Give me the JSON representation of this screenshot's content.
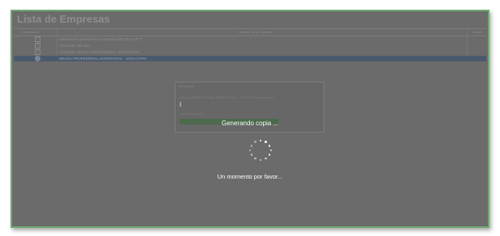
{
  "window": {
    "title": "Lista de Empresas"
  },
  "grid": {
    "columns": [
      "Seleccionar",
      "Nombre de la Empresa",
      "Estado"
    ],
    "rows": [
      {
        "name": "Información general de la empresa (HECHAS 2/FT)",
        "selected": false
      },
      {
        "name": "COLEGIO HELIXA",
        "selected": false
      },
      {
        "name": "COLEGIO HELIXA PROFESIONAL HORIZONTAL",
        "selected": false
      },
      {
        "name": "HELIXA PROFESIONAL HORIZONTAL - 2019 COPIA",
        "selected": true
      }
    ]
  },
  "dialog": {
    "title": "Generando",
    "text": "HELIXA PROFESIONAL HORIZONTAL - 2019 COPIA en proceso",
    "subtext": "Generando copia ..."
  },
  "overlay": {
    "status": "Generando copia ...",
    "message": "Un momento por favor..."
  }
}
